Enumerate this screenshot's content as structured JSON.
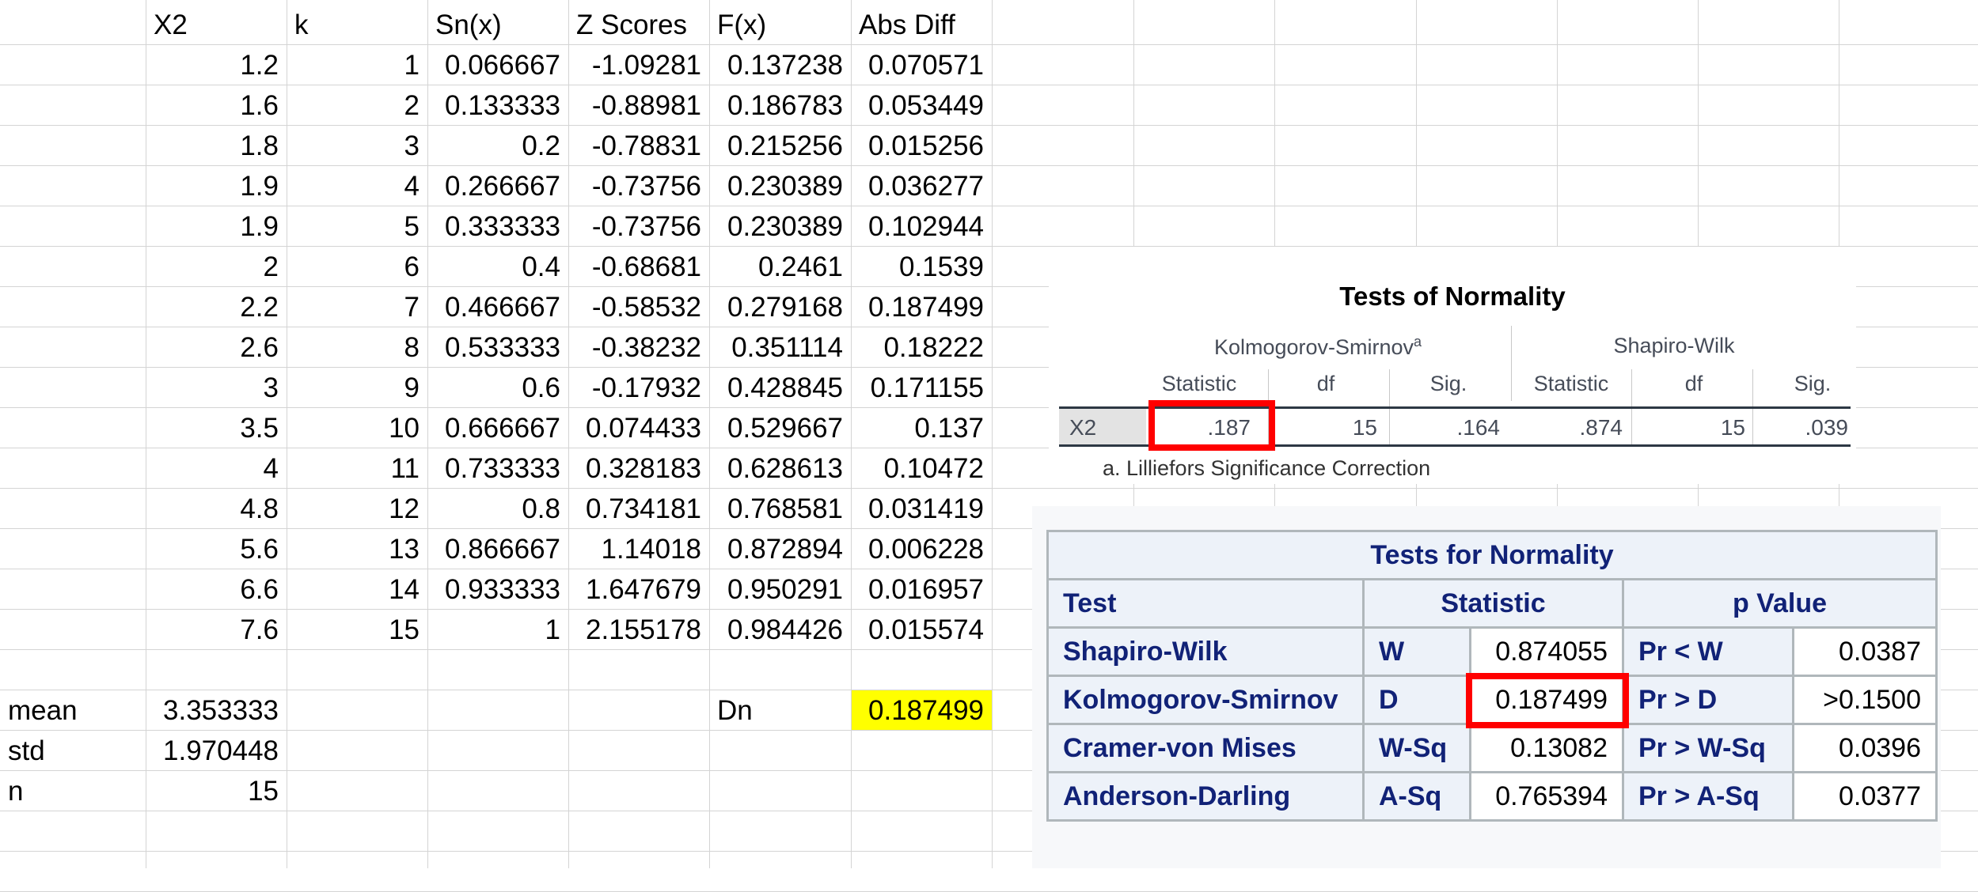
{
  "spreadsheet": {
    "headers": [
      "X2",
      "k",
      "Sn(x)",
      "Z Scores",
      "F(x)",
      "Abs Diff"
    ],
    "rows": [
      [
        "1.2",
        "1",
        "0.066667",
        "-1.09281",
        "0.137238",
        "0.070571"
      ],
      [
        "1.6",
        "2",
        "0.133333",
        "-0.88981",
        "0.186783",
        "0.053449"
      ],
      [
        "1.8",
        "3",
        "0.2",
        "-0.78831",
        "0.215256",
        "0.015256"
      ],
      [
        "1.9",
        "4",
        "0.266667",
        "-0.73756",
        "0.230389",
        "0.036277"
      ],
      [
        "1.9",
        "5",
        "0.333333",
        "-0.73756",
        "0.230389",
        "0.102944"
      ],
      [
        "2",
        "6",
        "0.4",
        "-0.68681",
        "0.2461",
        "0.1539"
      ],
      [
        "2.2",
        "7",
        "0.466667",
        "-0.58532",
        "0.279168",
        "0.187499"
      ],
      [
        "2.6",
        "8",
        "0.533333",
        "-0.38232",
        "0.351114",
        "0.18222"
      ],
      [
        "3",
        "9",
        "0.6",
        "-0.17932",
        "0.428845",
        "0.171155"
      ],
      [
        "3.5",
        "10",
        "0.666667",
        "0.074433",
        "0.529667",
        "0.137"
      ],
      [
        "4",
        "11",
        "0.733333",
        "0.328183",
        "0.628613",
        "0.10472"
      ],
      [
        "4.8",
        "12",
        "0.8",
        "0.734181",
        "0.768581",
        "0.031419"
      ],
      [
        "5.6",
        "13",
        "0.866667",
        "1.14018",
        "0.872894",
        "0.006228"
      ],
      [
        "6.6",
        "14",
        "0.933333",
        "1.647679",
        "0.950291",
        "0.016957"
      ],
      [
        "7.6",
        "15",
        "1",
        "2.155178",
        "0.984426",
        "0.015574"
      ]
    ],
    "summary": [
      {
        "label": "mean",
        "value": "3.353333"
      },
      {
        "label": "std",
        "value": "1.970448"
      },
      {
        "label": "n",
        "value": "15"
      }
    ],
    "dn_label": "Dn",
    "dn_value": "0.187499",
    "highlight_color": "#ffff00"
  },
  "spss": {
    "title": "Tests of Normality",
    "ks_group": "Kolmogorov-Smirnov",
    "ks_superscript": "a",
    "sw_group": "Shapiro-Wilk",
    "subheaders": [
      "Statistic",
      "df",
      "Sig.",
      "Statistic",
      "df",
      "Sig."
    ],
    "row_label": "X2",
    "values": [
      ".187",
      "15",
      ".164",
      ".874",
      "15",
      ".039"
    ],
    "footnote": "a. Lilliefors Significance Correction"
  },
  "sas": {
    "title": "Tests for Normality",
    "col_test": "Test",
    "col_statistic": "Statistic",
    "col_pvalue": "p Value",
    "rows": [
      {
        "test": "Shapiro-Wilk",
        "sym": "W",
        "stat": "0.874055",
        "plab": "Pr < W",
        "pval": "0.0387"
      },
      {
        "test": "Kolmogorov-Smirnov",
        "sym": "D",
        "stat": "0.187499",
        "plab": "Pr > D",
        "pval": ">0.1500"
      },
      {
        "test": "Cramer-von Mises",
        "sym": "W-Sq",
        "stat": "0.13082",
        "plab": "Pr > W-Sq",
        "pval": "0.0396"
      },
      {
        "test": "Anderson-Darling",
        "sym": "A-Sq",
        "stat": "0.765394",
        "plab": "Pr > A-Sq",
        "pval": "0.0377"
      }
    ],
    "header_text_color": "#112277",
    "header_bg_color": "#edf2f9"
  },
  "annotation_color": "#ff0000"
}
